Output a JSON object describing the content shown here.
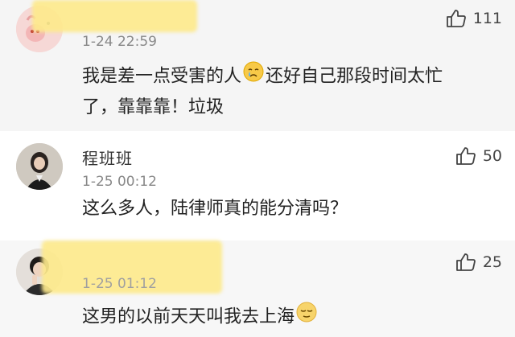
{
  "comments": [
    {
      "username": "",
      "timestamp": "1-24 22:59",
      "text_line1_before": "我是差一点受害的人",
      "text_line1_after": "还好自己那段时间太忙",
      "text_line2": "了，靠靠靠！垃圾",
      "emoji": "crying-face",
      "likes": "111"
    },
    {
      "username": "程班班",
      "timestamp": "1-25 00:12",
      "text": "这么多人，陆律师真的能分清吗？",
      "likes": "50"
    },
    {
      "username": "",
      "timestamp": "1-25 01:12",
      "text_before": "这男的以前天天叫我去上海",
      "emoji": "relieved-face",
      "likes": "25"
    }
  ],
  "colors": {
    "blur_highlight": "#fde98c",
    "background": "#f6f6f6"
  },
  "icons": [
    "thumbs-up-icon",
    "crying-face-emoji",
    "relieved-face-emoji"
  ]
}
